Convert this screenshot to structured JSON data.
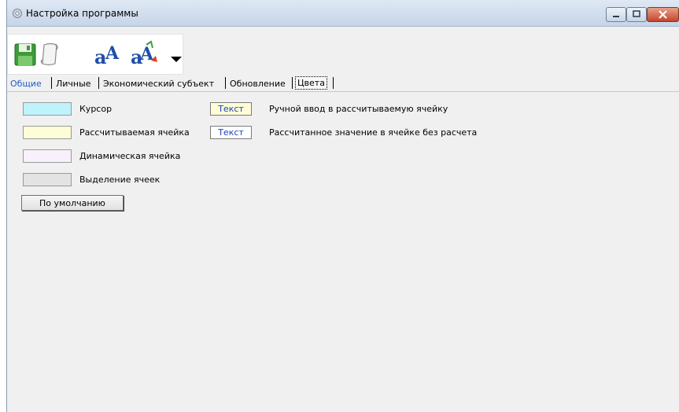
{
  "window": {
    "title": "Настройка программы"
  },
  "tabs": [
    {
      "label": "Общие"
    },
    {
      "label": "Личные"
    },
    {
      "label": "Экономический субъект"
    },
    {
      "label": "Обновление"
    },
    {
      "label": "Цвета"
    }
  ],
  "colors": {
    "cursor": "#bff3fb",
    "calculated": "#fdfdd7",
    "dynamic": "#f8f1fb",
    "selection": "#e3e3e3",
    "manual_sample_bg": "#fdfdd7",
    "calc_sample_bg": "#ffffff",
    "sample_text": "#1a3fc0"
  },
  "color_rows": [
    {
      "label": "Курсор"
    },
    {
      "label": "Рассчитываемая ячейка"
    },
    {
      "label": "Динамическая ячейка"
    },
    {
      "label": "Выделение ячеек"
    }
  ],
  "samples": [
    {
      "text": "Текст",
      "label": "Ручной ввод в рассчитываемую ячейку"
    },
    {
      "text": "Текст",
      "label": "Рассчитанное значение в ячейке без расчета"
    }
  ],
  "default_button": {
    "label": "По умолчанию"
  }
}
